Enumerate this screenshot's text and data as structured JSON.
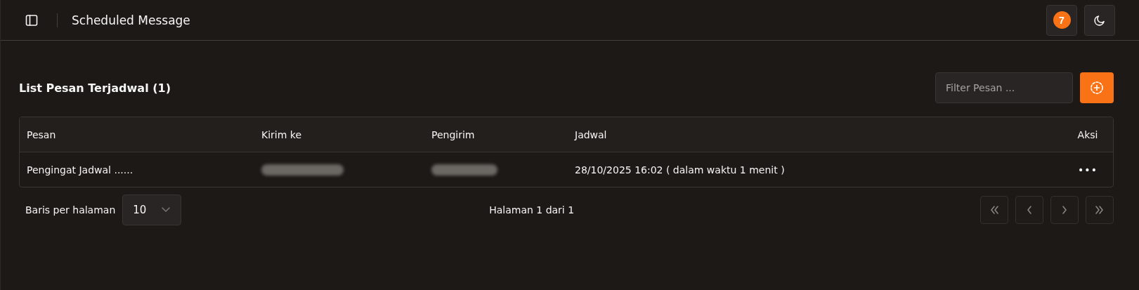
{
  "header": {
    "title": "Scheduled Message",
    "notification_count": "7"
  },
  "list": {
    "title": "List Pesan Terjadwal (1)",
    "filter": {
      "placeholder": "Filter Pesan ..."
    }
  },
  "table": {
    "columns": [
      "Pesan",
      "Kirim ke",
      "Pengirim",
      "Jadwal",
      "Aksi"
    ],
    "rows": [
      {
        "cells": [
          {
            "kind": "text",
            "text": "Pengingat Jadwal ......"
          },
          {
            "kind": "redacted"
          },
          {
            "kind": "redacted"
          },
          {
            "kind": "text",
            "text": "28/10/2025 16:02  ( dalam waktu 1 menit )"
          },
          {
            "kind": "menu",
            "text": "•••"
          }
        ]
      }
    ]
  },
  "pagination": {
    "rows_label": "Baris per halaman",
    "rows_value": "10",
    "page_label": "Halaman 1 dari 1",
    "buttons": [
      {
        "kind": "first",
        "disabled": true
      },
      {
        "kind": "prev",
        "disabled": true
      },
      {
        "kind": "next",
        "disabled": true
      },
      {
        "kind": "last",
        "disabled": true
      }
    ]
  }
}
